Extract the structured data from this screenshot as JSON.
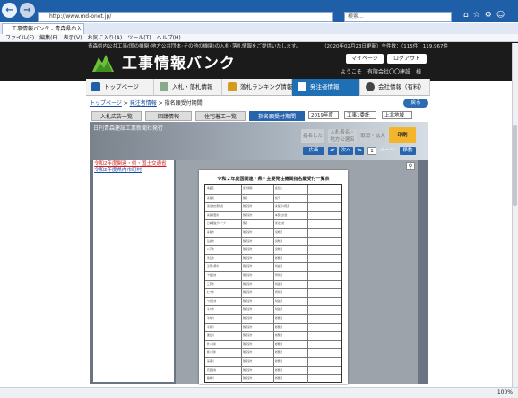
{
  "browser": {
    "url": "http://www.md-onet.jp/",
    "search_placeholder": "検索...",
    "tab_title": "工事情報バンク - 青森県の入…",
    "menu": [
      "ファイル(F)",
      "編集(E)",
      "表示(V)",
      "お気に入り(A)",
      "ツール(T)",
      "ヘルプ(H)"
    ],
    "zoom": "100%"
  },
  "site": {
    "banner_text": "青森県内公共工事(国の機関･地方公共団体･その他の機関)の入札･落札情報をご提供いたします。",
    "banner_date": "（2020年02月23日更新）全件数：（115件）119,967件",
    "logo_title": "工事情報バンク",
    "mypage_label": "マイページ",
    "logout_label": "ログアウト",
    "welcome": "ようこそ　有限会社〇〇建設　様"
  },
  "nav": [
    {
      "label": "トップページ"
    },
    {
      "label": "入札・落札情報"
    },
    {
      "label": "落札ランキング情報"
    },
    {
      "label": "発注者情報"
    },
    {
      "label": "会社情報（有料）"
    }
  ],
  "breadcrumb": [
    "トップページ",
    "発注者情報",
    "指名願受付期間"
  ],
  "back_label": "戻る",
  "subtabs": [
    "入札広告一覧",
    "回議情報",
    "住宅着工一覧",
    "指名願受付期間"
  ],
  "filters": {
    "year": "2019年度",
    "type": "工事1委託",
    "region": "上北地域"
  },
  "content": {
    "agency": "日刊青森建設工業新聞社発行",
    "buttons": {
      "designate": "指名した",
      "entry": "入札者名・地方公選名",
      "cancel": "取消・拡大",
      "print": "印刷",
      "expand": "広画",
      "next": "次へ",
      "page_label": "ページ",
      "move": "移動"
    },
    "doc_links": [
      "令和2年度関連・県・国土交通省",
      "令和2年度県内市町村"
    ],
    "document_title": "令和２年度国関連・県・主要発注機関指名願受付一覧表"
  },
  "doc_rows": [
    [
      "事業名",
      "受付期間",
      "提出先"
    ],
    [
      "青森県",
      "随時",
      "県庁"
    ],
    [
      "東北地方整備局",
      "随時受付",
      "青森河川国道"
    ],
    [
      "青森県警察",
      "随時受付",
      "本部会計課"
    ],
    [
      "日本郵政グループ",
      "随時",
      "東北支社"
    ],
    [
      "青森市",
      "随時受付",
      "契約課"
    ],
    [
      "弘前市",
      "随時受付",
      "契約課"
    ],
    [
      "八戸市",
      "随時受付",
      "契約課"
    ],
    [
      "黒石市",
      "随時受付",
      "総務課"
    ],
    [
      "五所川原市",
      "随時受付",
      "財政課"
    ],
    [
      "十和田市",
      "随時受付",
      "管財課"
    ],
    [
      "三沢市",
      "随時受付",
      "財政課"
    ],
    [
      "むつ市",
      "随時受付",
      "管財課"
    ],
    [
      "つがる市",
      "随時受付",
      "財政課"
    ],
    [
      "平川市",
      "随時受付",
      "財政課"
    ],
    [
      "平内町",
      "随時受付",
      "総務課"
    ],
    [
      "今別町",
      "随時受付",
      "総務課"
    ],
    [
      "蓬田村",
      "随時受付",
      "総務課"
    ],
    [
      "外ヶ浜町",
      "随時受付",
      "総務課"
    ],
    [
      "鰺ヶ沢町",
      "随時受付",
      "総務課"
    ],
    [
      "深浦町",
      "随時受付",
      "総務課"
    ],
    [
      "西目屋村",
      "随時受付",
      "総務課"
    ],
    [
      "藤崎町",
      "随時受付",
      "総務課"
    ]
  ]
}
